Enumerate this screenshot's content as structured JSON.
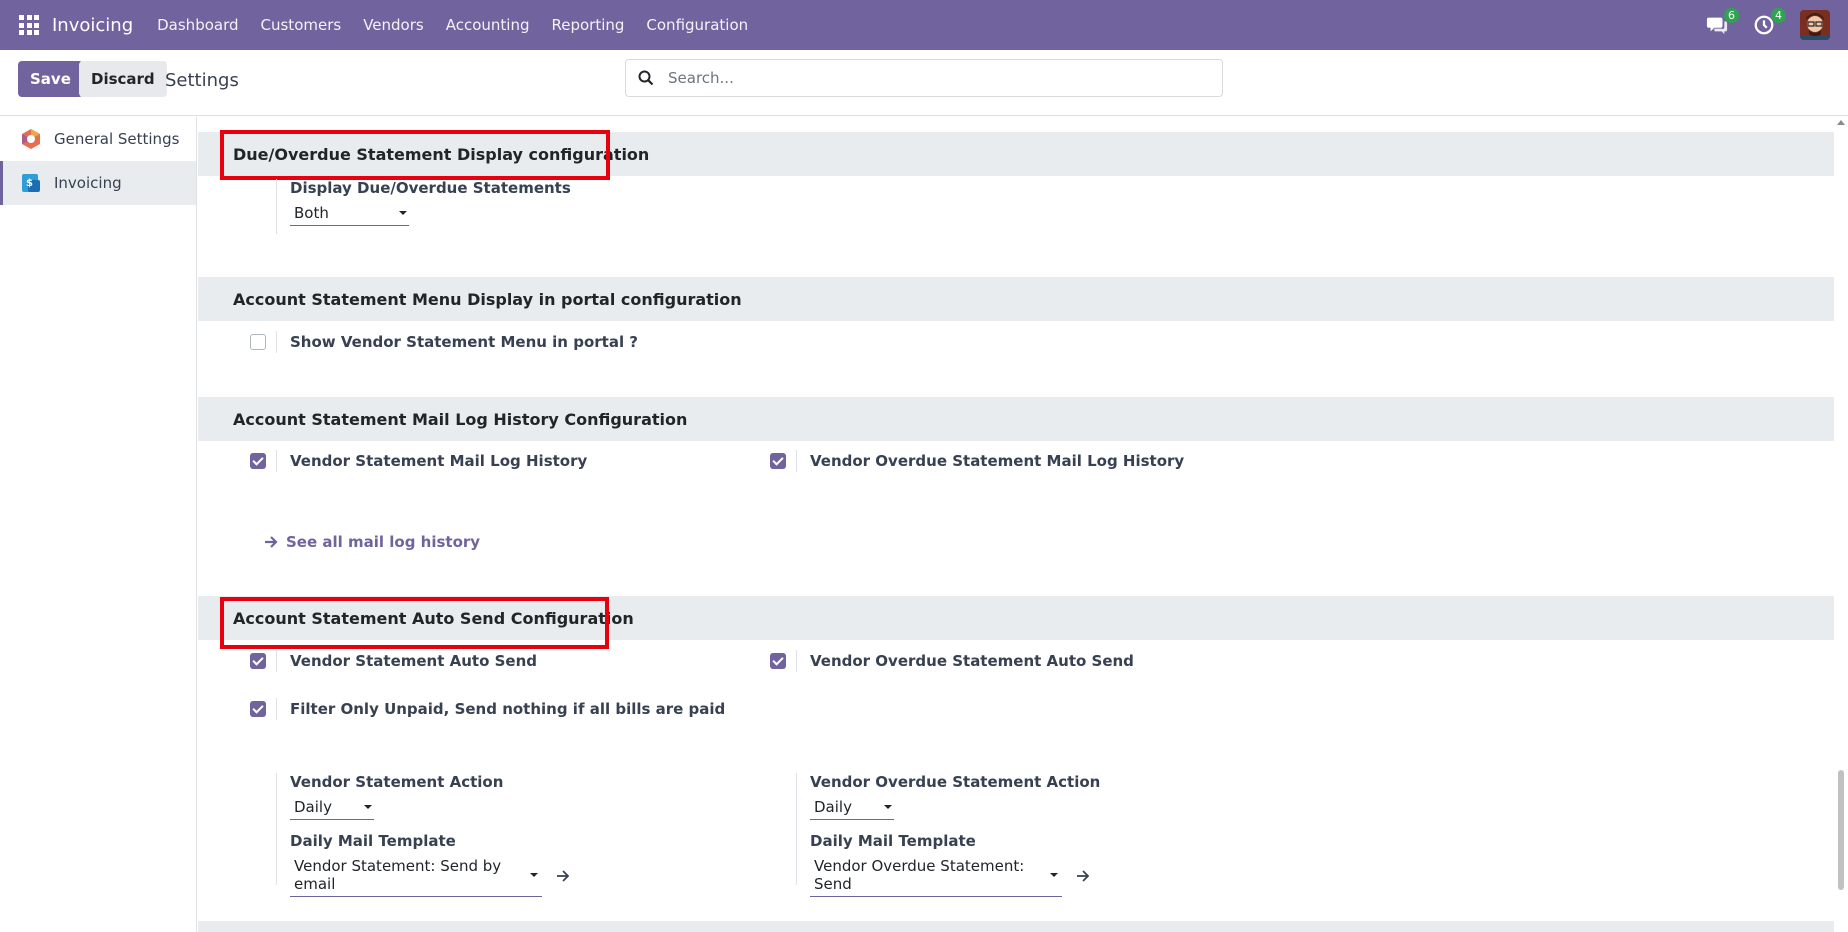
{
  "navbar": {
    "brand": "Invoicing",
    "menu": [
      "Dashboard",
      "Customers",
      "Vendors",
      "Accounting",
      "Reporting",
      "Configuration"
    ],
    "messages_count": "6",
    "activities_count": "4"
  },
  "control": {
    "save_label": "Save",
    "discard_label": "Discard",
    "title": "Settings",
    "search_placeholder": "Search..."
  },
  "sidebar": {
    "items": [
      {
        "label": "General Settings",
        "icon": "odoo-icon",
        "active": false
      },
      {
        "label": "Invoicing",
        "icon": "invoicing-icon",
        "active": true
      }
    ]
  },
  "sections": {
    "due_overdue": {
      "title": "Due/Overdue Statement Display configuration",
      "field_label": "Display Due/Overdue Statements",
      "field_value": "Both"
    },
    "menu_portal": {
      "title": "Account Statement Menu Display in portal configuration",
      "checkbox_label": "Show Vendor Statement Menu in portal ?",
      "checked": false
    },
    "mail_log": {
      "title": "Account Statement Mail Log History Configuration",
      "left_label": "Vendor Statement Mail Log History",
      "right_label": "Vendor Overdue Statement Mail Log History",
      "link": "See all mail log history"
    },
    "auto_send": {
      "title": "Account Statement Auto Send Configuration",
      "left_label": "Vendor Statement Auto Send",
      "right_label": "Vendor Overdue Statement Auto Send",
      "filter_label": "Filter Only Unpaid, Send nothing if all bills are paid",
      "left_action_label": "Vendor Statement Action",
      "left_action_value": "Daily",
      "left_template_label": "Daily Mail Template",
      "left_template_value": "Vendor Statement: Send by email",
      "right_action_label": "Vendor Overdue Statement Action",
      "right_action_value": "Daily",
      "right_template_label": "Daily Mail Template",
      "right_template_value": "Vendor Overdue Statement: Send"
    }
  },
  "colors": {
    "brand": "#71639e",
    "highlight": "#e8000e",
    "section_bg": "#e9ecef"
  }
}
